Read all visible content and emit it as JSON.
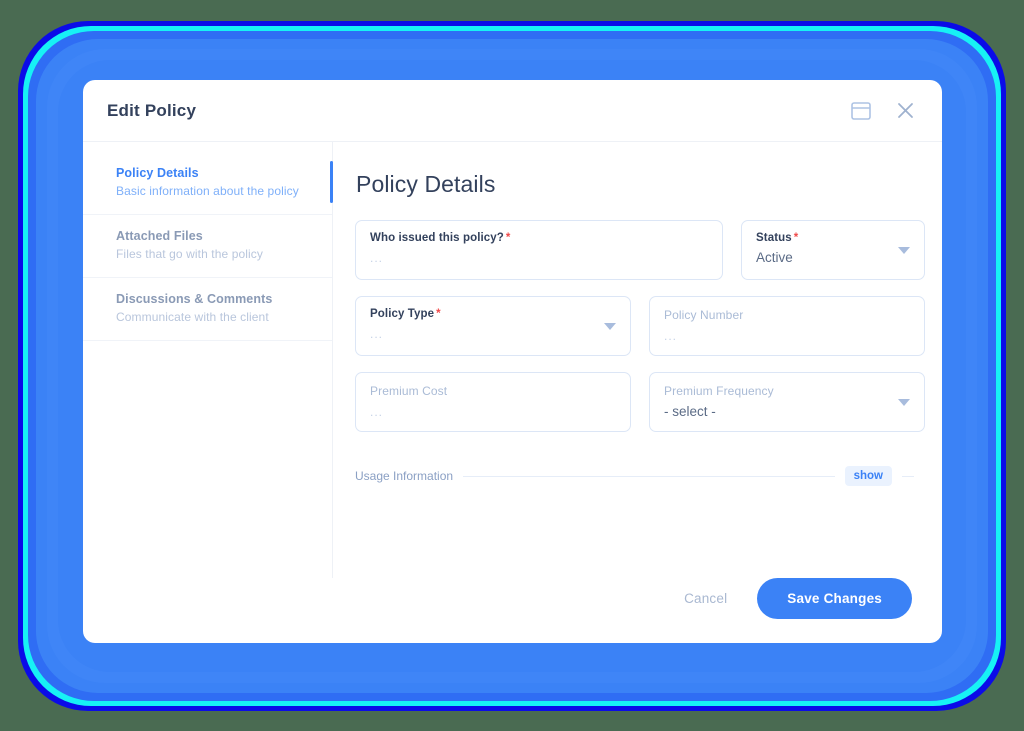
{
  "window": {
    "background_color": "#4a6b52",
    "glow_colors": [
      "#0b0be8",
      "#17f1f5",
      "#2f6df4",
      "#3b82f6"
    ]
  },
  "header": {
    "title": "Edit Policy",
    "accent_color": "#3b82f6",
    "actions": [
      {
        "name": "window-icon",
        "tooltip": ""
      },
      {
        "name": "close-icon",
        "tooltip": ""
      }
    ]
  },
  "sidebar": {
    "items": [
      {
        "label": "Policy Details",
        "sublabel": "Basic information about the policy",
        "active": true
      },
      {
        "label": "Attached Files",
        "sublabel": "Files that go with the policy",
        "active": false
      },
      {
        "label": "Discussions & Comments",
        "sublabel": "Communicate with the client",
        "active": false
      }
    ]
  },
  "main": {
    "section_title": "Policy Details",
    "fields": {
      "issuer": {
        "label": "Who issued this policy?",
        "required": true,
        "required_mark": "*",
        "value": "...",
        "empty": true
      },
      "status": {
        "label": "Status",
        "required": true,
        "required_mark": "*",
        "value": "Active",
        "empty": false
      },
      "policy_type": {
        "label": "Policy Type",
        "required": true,
        "required_mark": "*",
        "value": "...",
        "empty": true
      },
      "policy_number": {
        "label": "Policy Number",
        "required": false,
        "value": "...",
        "empty": true
      },
      "premium_cost": {
        "label": "Premium Cost",
        "required": false,
        "value": "...",
        "empty": true
      },
      "premium_frequency": {
        "label": "Premium Frequency",
        "required": false,
        "value": "- select -",
        "empty": false
      }
    },
    "usage": {
      "label": "Usage Information",
      "toggle_label": "show"
    }
  },
  "footer": {
    "cancel_label": "Cancel",
    "save_label": "Save Changes",
    "save_color": "#3b82f6"
  }
}
